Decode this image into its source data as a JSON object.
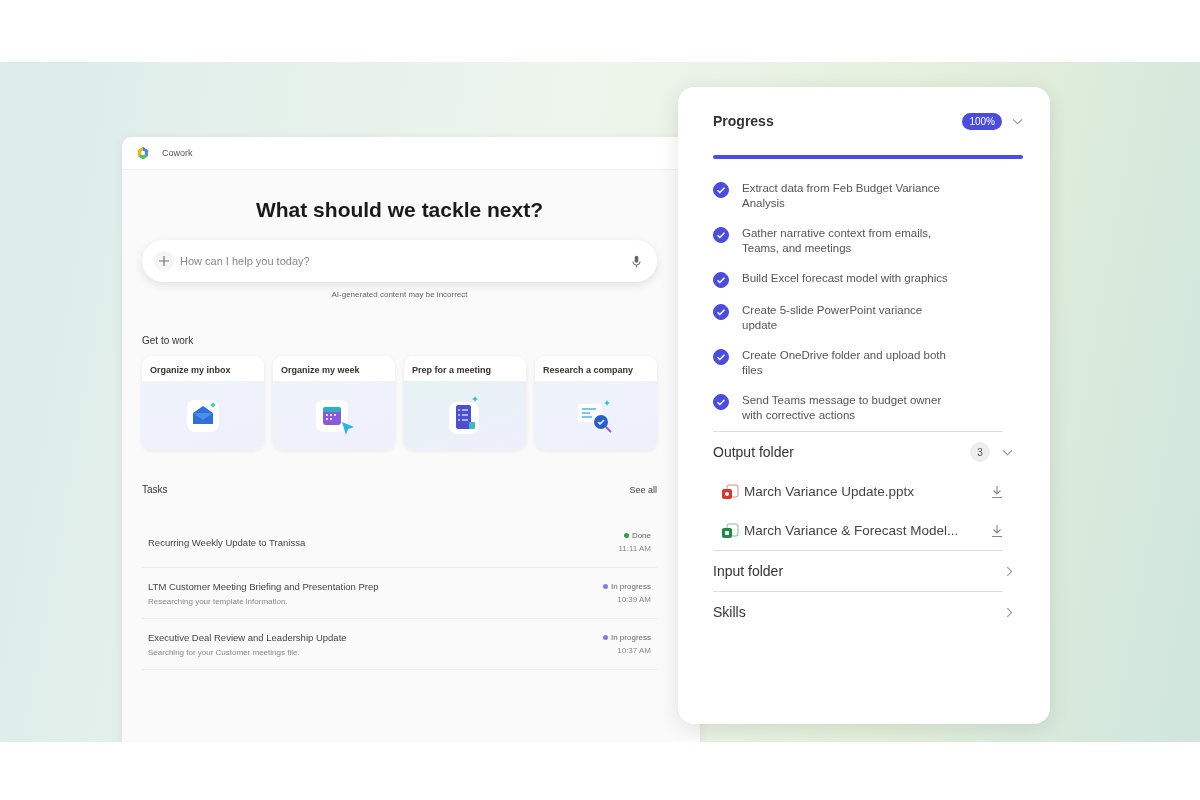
{
  "app": {
    "title": "Cowork",
    "heading": "What should we tackle next?",
    "search": {
      "placeholder": "How can I help you today?"
    },
    "disclaimer": "AI-generated content may be incorrect",
    "get_to_work": {
      "title": "Get to work",
      "cards": [
        {
          "label": "Organize my inbox",
          "kind": "mail"
        },
        {
          "label": "Organize my week",
          "kind": "calendar"
        },
        {
          "label": "Prep for a meeting",
          "kind": "checklist"
        },
        {
          "label": "Research a company",
          "kind": "research"
        }
      ]
    },
    "tasks": {
      "title": "Tasks",
      "see_all": "See all",
      "rows": [
        {
          "title": "Recurring Weekly Update to Tranissa",
          "status": "Done",
          "color": "#2e9e3e",
          "time": "11:11 AM"
        },
        {
          "title": "LTM Customer Meeting Briefing and Presentation Prep",
          "subtitle": "Researching your template information.",
          "status": "In progress",
          "color": "#7b7ff0",
          "time": "10:39 AM"
        },
        {
          "title": "Executive Deal Review and Leadership Update",
          "subtitle": "Searching for your Customer meetings file.",
          "status": "In progress",
          "color": "#7b7ff0",
          "time": "10:37 AM"
        }
      ]
    }
  },
  "panel": {
    "progress": {
      "title": "Progress",
      "badge": "100%",
      "level": 1.0,
      "steps": [
        {
          "label": "Extract data from Feb Budget Variance Analysis",
          "checked": true
        },
        {
          "label": "Gather narrative context from emails, Teams, and meetings",
          "checked": true
        },
        {
          "label": "Build Excel forecast model with graphics",
          "checked": true
        },
        {
          "label": "Create 5-slide PowerPoint variance update",
          "checked": true
        },
        {
          "label": "Create OneDrive folder and upload both files",
          "checked": true
        },
        {
          "label": "Send Teams message to budget owner with corrective actions",
          "checked": true
        }
      ]
    },
    "sections": [
      {
        "title": "Output folder",
        "count": "3",
        "expanded": true,
        "files": [
          {
            "name": "March Variance Update.pptx",
            "kind": "pptx"
          },
          {
            "name": "March Variance & Forecast Model...",
            "kind": "xlsx"
          }
        ]
      },
      {
        "title": "Input folder",
        "expanded": false
      },
      {
        "title": "Skills",
        "expanded": false
      }
    ]
  }
}
